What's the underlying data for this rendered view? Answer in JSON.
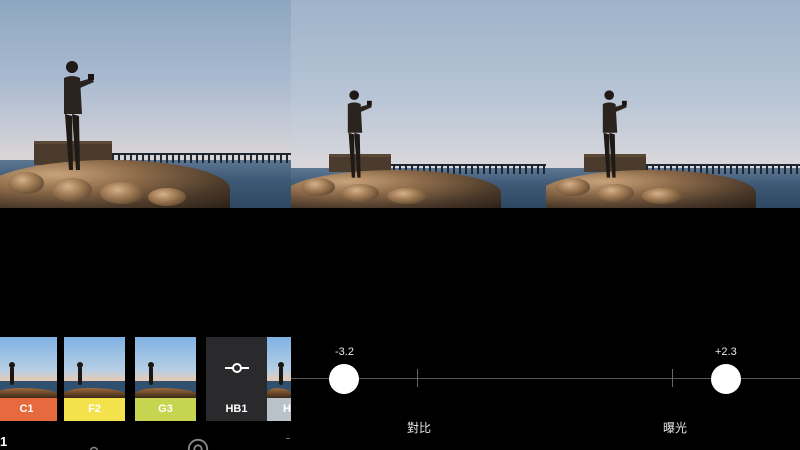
{
  "panel_filters": {
    "filters": [
      {
        "label": "C1",
        "color": "#e66a3e"
      },
      {
        "label": "F2",
        "color": "#f4e24c"
      },
      {
        "label": "G3",
        "color": "#c6d44f"
      },
      {
        "label": "HB1",
        "icon": "slider-adjust-icon"
      },
      {
        "label": "H"
      }
    ],
    "bottom_bar": {
      "partial_label": "1",
      "icons": [
        "adjust-slider-icon",
        "camera-lens-icon",
        "more-icon"
      ]
    }
  },
  "panel_contrast": {
    "value": "-3.2",
    "label": "對比",
    "level": -3.2
  },
  "panel_exposure": {
    "value": "+2.3",
    "label": "曝光",
    "level": 2.3
  }
}
